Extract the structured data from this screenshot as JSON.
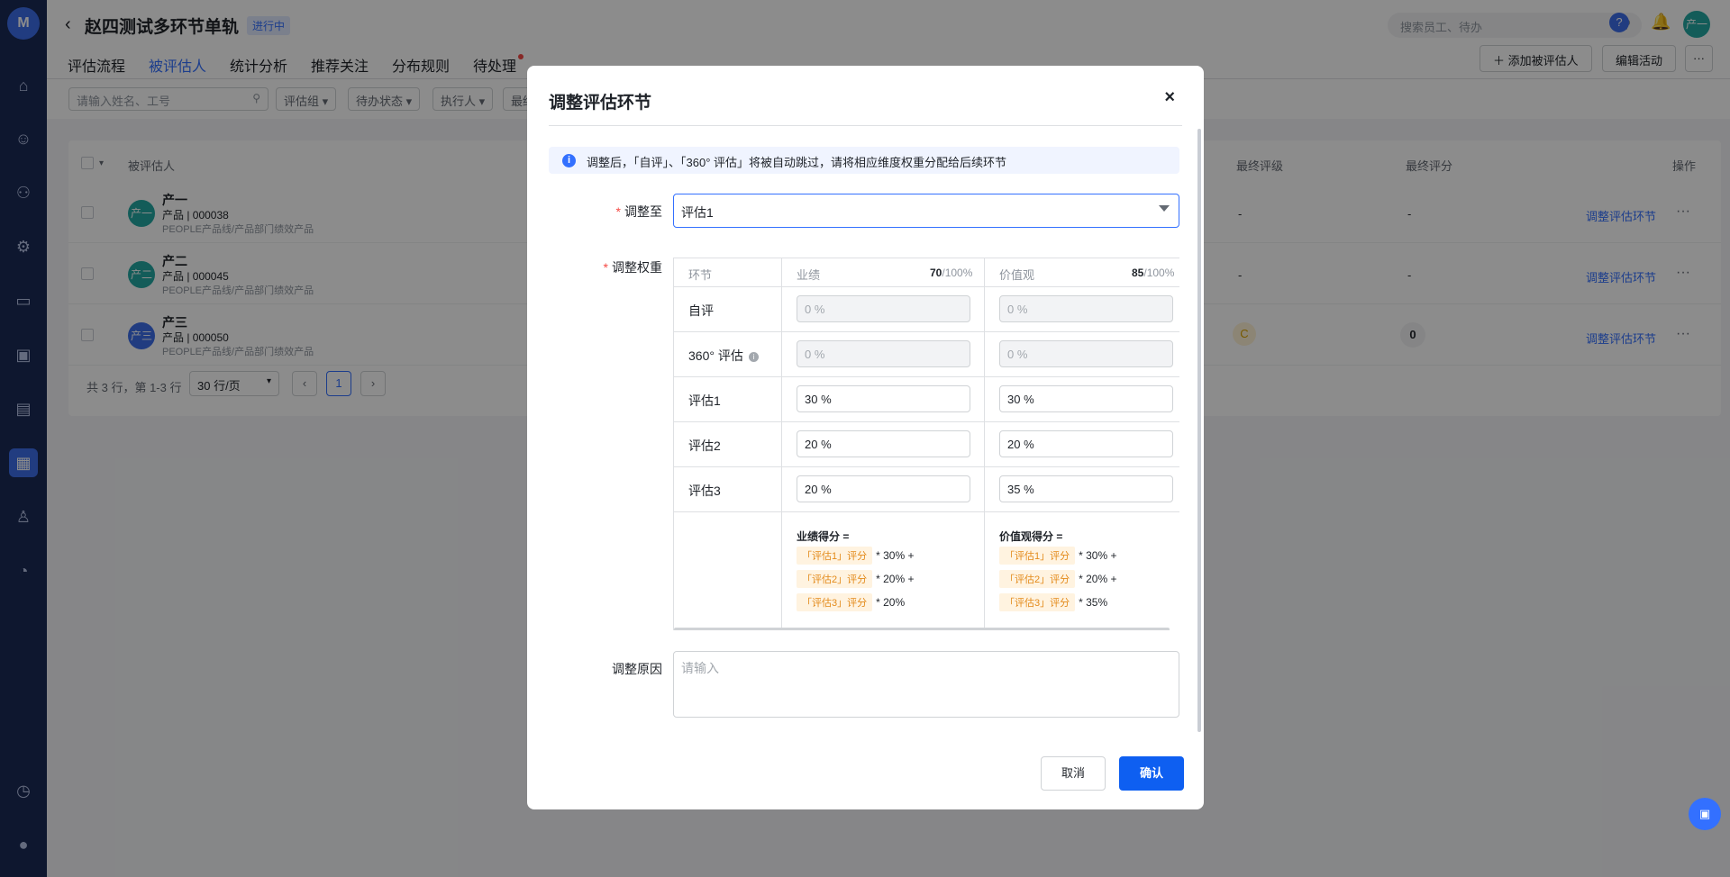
{
  "header": {
    "title": "赵四测试多环节单轨",
    "status": "进行中",
    "search_placeholder": "搜索员工、待办",
    "user_initial": "产一"
  },
  "tabs": [
    {
      "label": "评估流程"
    },
    {
      "label": "被评估人"
    },
    {
      "label": "统计分析"
    },
    {
      "label": "推荐关注"
    },
    {
      "label": "分布规则"
    },
    {
      "label": "待处理"
    }
  ],
  "actions": {
    "add_label": "添加被评估人",
    "edit_label": "编辑活动",
    "more_label": "···"
  },
  "filters": {
    "search_placeholder": "请输入姓名、工号",
    "group": "评估组",
    "todo_status": "待办状态",
    "executor": "执行人",
    "final": "最终"
  },
  "table": {
    "col_person": "被评估人",
    "col_final_level": "最终评级",
    "col_final_score": "最终评分",
    "col_ops": "操作",
    "rows": [
      {
        "initial": "产一",
        "name": "产一",
        "meta": "产品 | 000038",
        "dept": "PEOPLE产品线/产品部门绩效产品",
        "level": "-",
        "score": "-",
        "link": "调整评估环节",
        "more": "···"
      },
      {
        "initial": "产二",
        "name": "产二",
        "meta": "产品 | 000045",
        "dept": "PEOPLE产品线/产品部门绩效产品",
        "level": "-",
        "score": "-",
        "link": "调整评估环节",
        "more": "···"
      },
      {
        "initial": "产三",
        "name": "产三",
        "meta": "产品 | 000050",
        "dept": "PEOPLE产品线/产品部门绩效产品",
        "level": "C",
        "score": "0",
        "link": "调整评估环节",
        "more": "···"
      }
    ],
    "summary": "共 3 行，第 1-3 行",
    "page_size": "30 行/页",
    "prev": "‹",
    "page": "1",
    "next": "›"
  },
  "modal": {
    "title": "调整评估环节",
    "close": "×",
    "alert": "调整后，「自评」、「360° 评估」将被自动跳过，请将相应维度权重分配给后续环节",
    "adjust_to_label": "调整至",
    "adjust_to_value": "评估1",
    "weight_label": "调整权重",
    "reason_label": "调整原因",
    "reason_placeholder": "请输入",
    "weights": {
      "col_stage": "环节",
      "col1": {
        "name": "业绩",
        "total": "70",
        "max": "/100%"
      },
      "col2": {
        "name": "价值观",
        "total": "85",
        "max": "/100%"
      },
      "rows": [
        {
          "stage": "自评",
          "v1": "0 %",
          "v2": "0 %",
          "disabled": true
        },
        {
          "stage": "360° 评估",
          "v1": "0 %",
          "v2": "0 %",
          "disabled": true
        },
        {
          "stage": "评估1",
          "v1": "30 %",
          "v2": "30 %",
          "disabled": false
        },
        {
          "stage": "评估2",
          "v1": "20 %",
          "v2": "20 %",
          "disabled": false
        },
        {
          "stage": "评估3",
          "v1": "20 %",
          "v2": "35 %",
          "disabled": false
        }
      ],
      "formula1": {
        "title": "业绩得分 =",
        "lines": [
          {
            "tag": "「评估1」评分",
            "text": "* 30% +"
          },
          {
            "tag": "「评估2」评分",
            "text": "* 20% +"
          },
          {
            "tag": "「评估3」评分",
            "text": "* 20%"
          }
        ]
      },
      "formula2": {
        "title": "价值观得分 =",
        "lines": [
          {
            "tag": "「评估1」评分",
            "text": "* 30% +"
          },
          {
            "tag": "「评估2」评分",
            "text": "* 20% +"
          },
          {
            "tag": "「评估3」评分",
            "text": "* 35%"
          }
        ]
      }
    },
    "cancel_label": "取消",
    "confirm_label": "确认"
  }
}
